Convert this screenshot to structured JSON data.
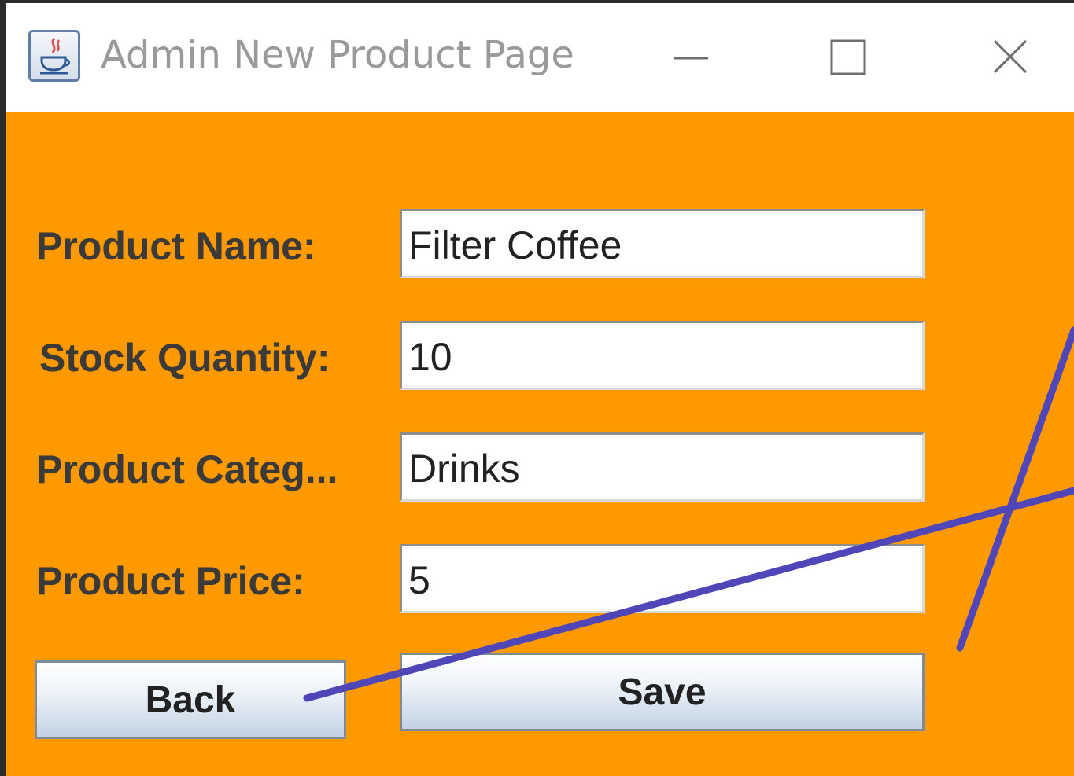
{
  "window": {
    "title": "Admin New Product Page",
    "icon": "java-coffee-cup-icon",
    "controls": [
      "minimize-icon",
      "maximize-icon",
      "close-icon"
    ],
    "background": "#ff9900"
  },
  "form": {
    "fields": [
      {
        "label": "Product Name:",
        "value": "Filter Coffee"
      },
      {
        "label": "Stock Quantity:",
        "value": "10"
      },
      {
        "label": "Product Categ...",
        "value": "Drinks"
      },
      {
        "label": "Product Price:",
        "value": "5"
      }
    ],
    "buttons": {
      "back": "Back",
      "save": "Save"
    }
  },
  "annotation": {
    "color": "#5046b8"
  }
}
